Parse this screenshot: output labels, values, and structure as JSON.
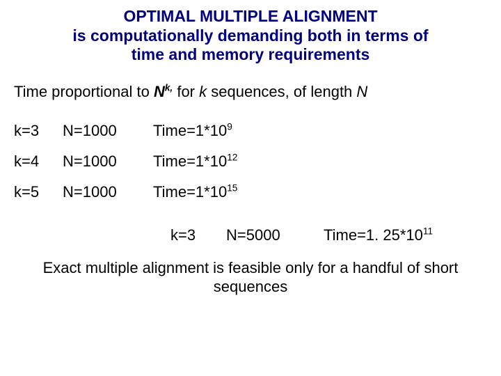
{
  "title": {
    "line1": "OPTIMAL MULTIPLE ALIGNMENT",
    "line2": "is computationally demanding both in terms of",
    "line3": "time and memory requirements"
  },
  "subtitle": {
    "prefix": "Time proportional to ",
    "var1": "N",
    "sup1": "k,",
    "mid": " for ",
    "var2": "k ",
    "mid2": "sequences, of length ",
    "var3": "N"
  },
  "rows": [
    {
      "k": "k=3",
      "n": "N=1000",
      "t_pre": "Time=1*10",
      "t_exp": "9"
    },
    {
      "k": "k=4",
      "n": "N=1000",
      "t_pre": "Time=1*10",
      "t_exp": "12"
    },
    {
      "k": "k=5",
      "n": "N=1000",
      "t_pre": "Time=1*10",
      "t_exp": "15"
    }
  ],
  "extra": {
    "k": "k=3",
    "n": "N=5000",
    "t_pre": "Time=1. 25*10",
    "t_exp": "11"
  },
  "conclusion": "Exact multiple alignment is feasible only for a handful of short sequences"
}
